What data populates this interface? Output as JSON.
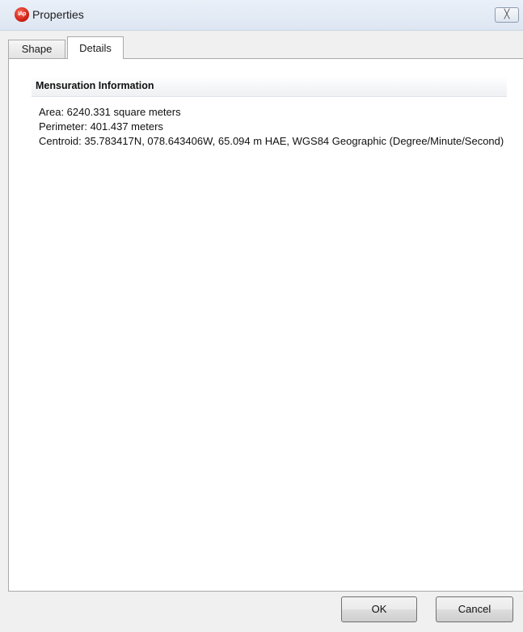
{
  "window": {
    "title": "Properties",
    "app_icon_text": "IAp",
    "close_glyph": "╳"
  },
  "tabs": [
    {
      "label": "Shape",
      "selected": false
    },
    {
      "label": "Details",
      "selected": true
    }
  ],
  "details": {
    "section_title": "Mensuration Information",
    "lines": [
      "Area: 6240.331 square meters",
      "Perimeter: 401.437 meters",
      "Centroid: 35.783417N, 078.643406W, 65.094 m HAE, WGS84 Geographic (Degree/Minute/Second)"
    ]
  },
  "buttons": {
    "ok": "OK",
    "cancel": "Cancel"
  },
  "icons": {
    "app": "app-logo-icon",
    "close": "close-icon"
  }
}
